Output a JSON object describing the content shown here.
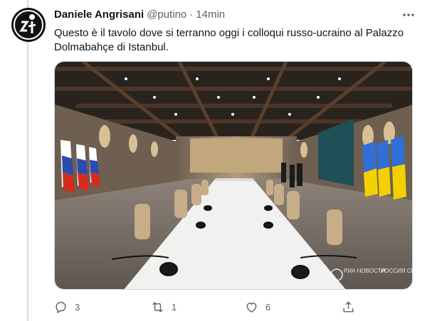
{
  "tweet": {
    "author_name": "Daniele Angrisani",
    "handle": "@putino",
    "separator": "·",
    "time": "14min",
    "text": "Questo è il tavolo dove si terranno oggi i colloqui russo-ucraino al Palazzo Dolmabahçe di Istanbul.",
    "watermark_brand": "РИА НОВОСТИ",
    "watermark_caption": "РОССИЯ СЕГОДНЯ"
  },
  "actions": {
    "reply_count": "3",
    "retweet_count": "1",
    "like_count": "6"
  },
  "colors": {
    "text_primary": "#0f1419",
    "text_secondary": "#536471",
    "border": "#cfd9de"
  },
  "icons": {
    "more": "more-dots-icon",
    "reply": "reply-icon",
    "retweet": "retweet-icon",
    "like": "like-icon",
    "share": "share-icon"
  }
}
